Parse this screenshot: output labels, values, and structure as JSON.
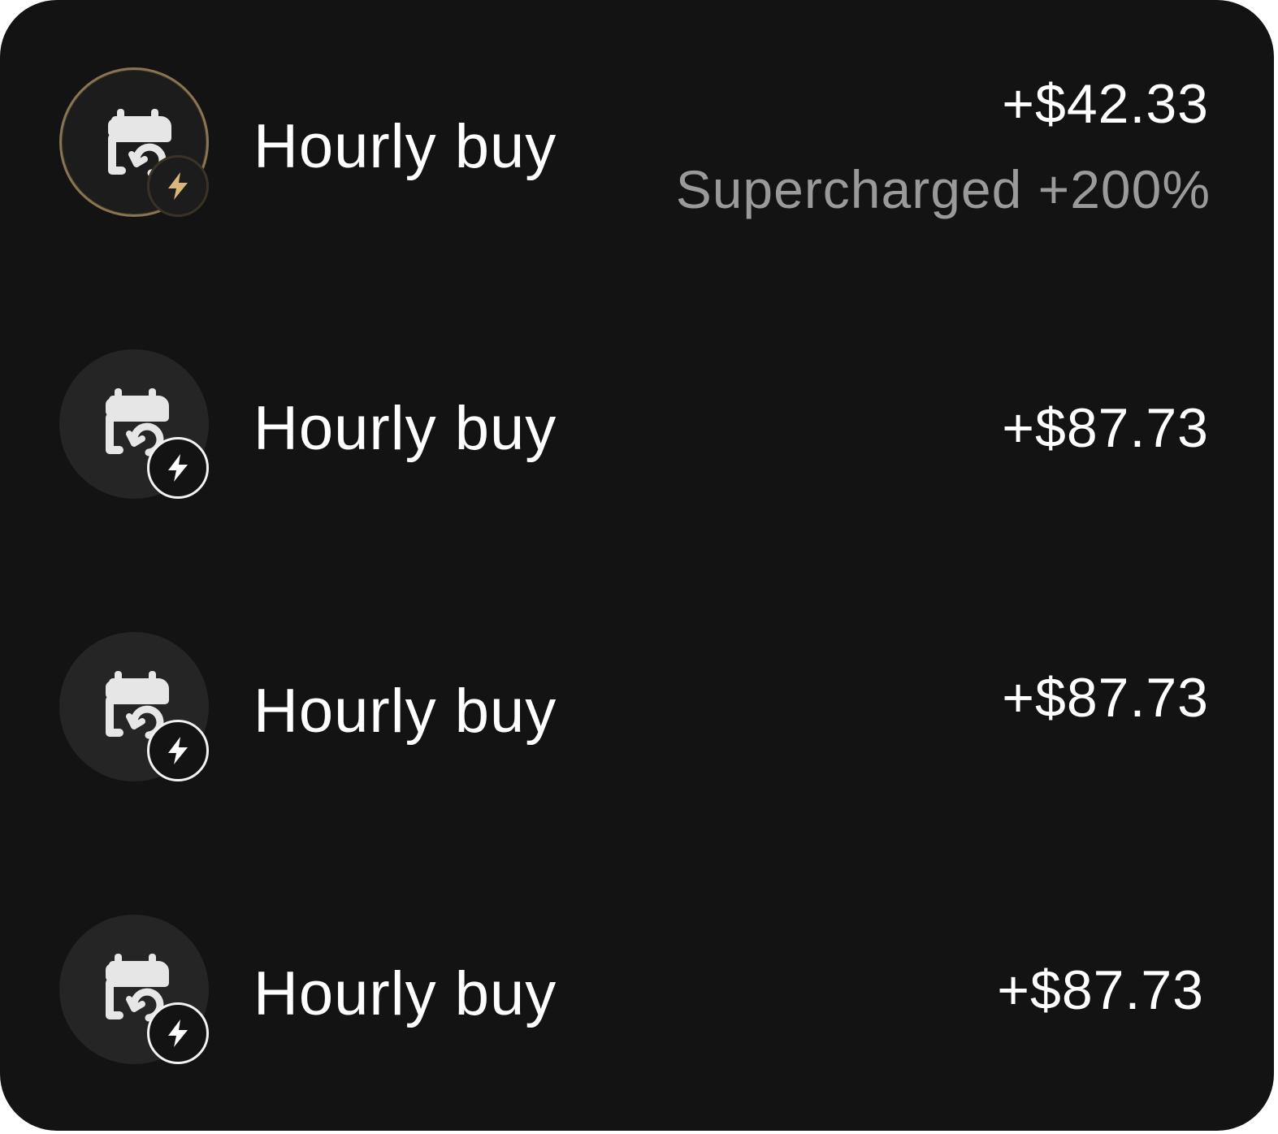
{
  "colors": {
    "background": "#131313",
    "text_primary": "#ffffff",
    "text_secondary": "#9a9a9a",
    "accent_gold": "#d9b77a",
    "icon_bg": "#252525"
  },
  "transactions": [
    {
      "title": "Hourly buy",
      "amount": "+$42.33",
      "note": "Supercharged +200%",
      "icon": "calendar-repeat-icon",
      "badge_icon": "lightning-bolt-icon",
      "highlighted": true
    },
    {
      "title": "Hourly buy",
      "amount": "+$87.73",
      "icon": "calendar-repeat-icon",
      "badge_icon": "lightning-bolt-icon",
      "highlighted": false
    },
    {
      "title": "Hourly buy",
      "amount": "+$87.73",
      "icon": "calendar-repeat-icon",
      "badge_icon": "lightning-bolt-icon",
      "highlighted": false
    },
    {
      "title": "Hourly buy",
      "amount": "+$87.73",
      "icon": "calendar-repeat-icon",
      "badge_icon": "lightning-bolt-icon",
      "highlighted": false
    }
  ]
}
